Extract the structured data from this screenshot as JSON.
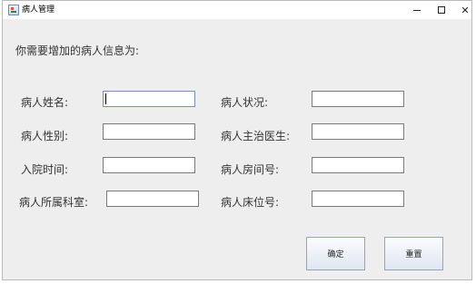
{
  "window": {
    "title": "病人管理",
    "minimize_label": "–",
    "close_label": "✕"
  },
  "form": {
    "heading": "你需要增加的病人信息为:",
    "left": [
      {
        "label": "病人姓名:",
        "value": ""
      },
      {
        "label": "病人性别:",
        "value": ""
      },
      {
        "label": "入院时间:",
        "value": ""
      },
      {
        "label": "病人所属科室:",
        "value": ""
      }
    ],
    "right": [
      {
        "label": "病人状况:",
        "value": ""
      },
      {
        "label": "病人主治医生:",
        "value": ""
      },
      {
        "label": "病人房间号:",
        "value": ""
      },
      {
        "label": "病人床位号:",
        "value": ""
      }
    ]
  },
  "buttons": {
    "confirm": "确定",
    "reset": "重置"
  },
  "icons": {
    "app": "app-icon",
    "minimize": "minimize-icon",
    "maximize": "maximize-icon",
    "close": "close-icon"
  }
}
